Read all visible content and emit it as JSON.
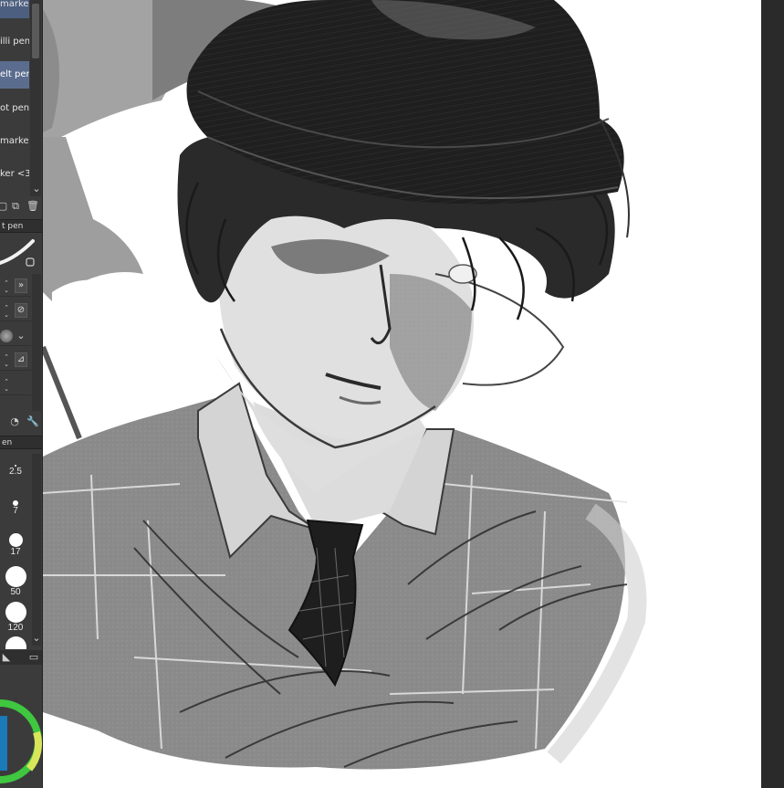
{
  "subtool_list": {
    "items": [
      {
        "label": "marker",
        "state": "hover"
      },
      {
        "label": "illi pen",
        "state": "normal"
      },
      {
        "label": "elt pen",
        "state": "selected"
      },
      {
        "label": "ot pen",
        "state": "normal"
      },
      {
        "label": "marker",
        "state": "normal"
      },
      {
        "label": "ker <3",
        "state": "normal"
      }
    ]
  },
  "tool_property": {
    "tab_label": "t pen"
  },
  "brush_size": {
    "tab_label": "en",
    "sizes": [
      "2.5",
      "7",
      "17",
      "50",
      "120"
    ]
  },
  "colors": {
    "panel_bg": "#3b3b3b",
    "selected": "#5b6d8e",
    "canvas_bg": "#ffffff",
    "color_ring": "#3fc73f"
  }
}
